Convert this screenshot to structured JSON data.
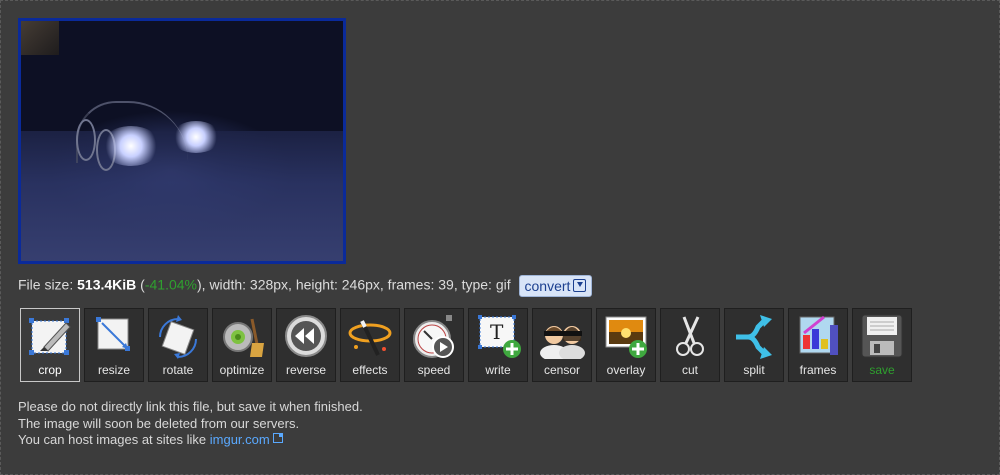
{
  "file_info": {
    "prefix": "File size: ",
    "size": "513.4KiB",
    "open_paren": " (",
    "percent": "-41.04%",
    "details": "), width: 328px, height: 246px, frames: 39, type: gif",
    "convert_label": "convert"
  },
  "tools": [
    {
      "label": "crop",
      "icon": "crop-icon",
      "active": true
    },
    {
      "label": "resize",
      "icon": "resize-icon"
    },
    {
      "label": "rotate",
      "icon": "rotate-icon"
    },
    {
      "label": "optimize",
      "icon": "optimize-icon"
    },
    {
      "label": "reverse",
      "icon": "reverse-icon"
    },
    {
      "label": "effects",
      "icon": "effects-icon"
    },
    {
      "label": "speed",
      "icon": "speed-icon"
    },
    {
      "label": "write",
      "icon": "write-icon"
    },
    {
      "label": "censor",
      "icon": "censor-icon"
    },
    {
      "label": "overlay",
      "icon": "overlay-icon"
    },
    {
      "label": "cut",
      "icon": "scissors-icon"
    },
    {
      "label": "split",
      "icon": "split-icon"
    },
    {
      "label": "frames",
      "icon": "frames-icon"
    },
    {
      "label": "save",
      "icon": "save-icon"
    }
  ],
  "notes": {
    "line1": "Please do not directly link this file, but save it when finished.",
    "line2": "The image will soon be deleted from our servers.",
    "line3_prefix": "You can host images at sites like ",
    "link_text": "imgur.com"
  },
  "colors": {
    "background": "#3c3c3c",
    "preview_border": "#0a2a9a",
    "percent_green": "#2fa02f",
    "link_blue": "#5aa9ff"
  }
}
